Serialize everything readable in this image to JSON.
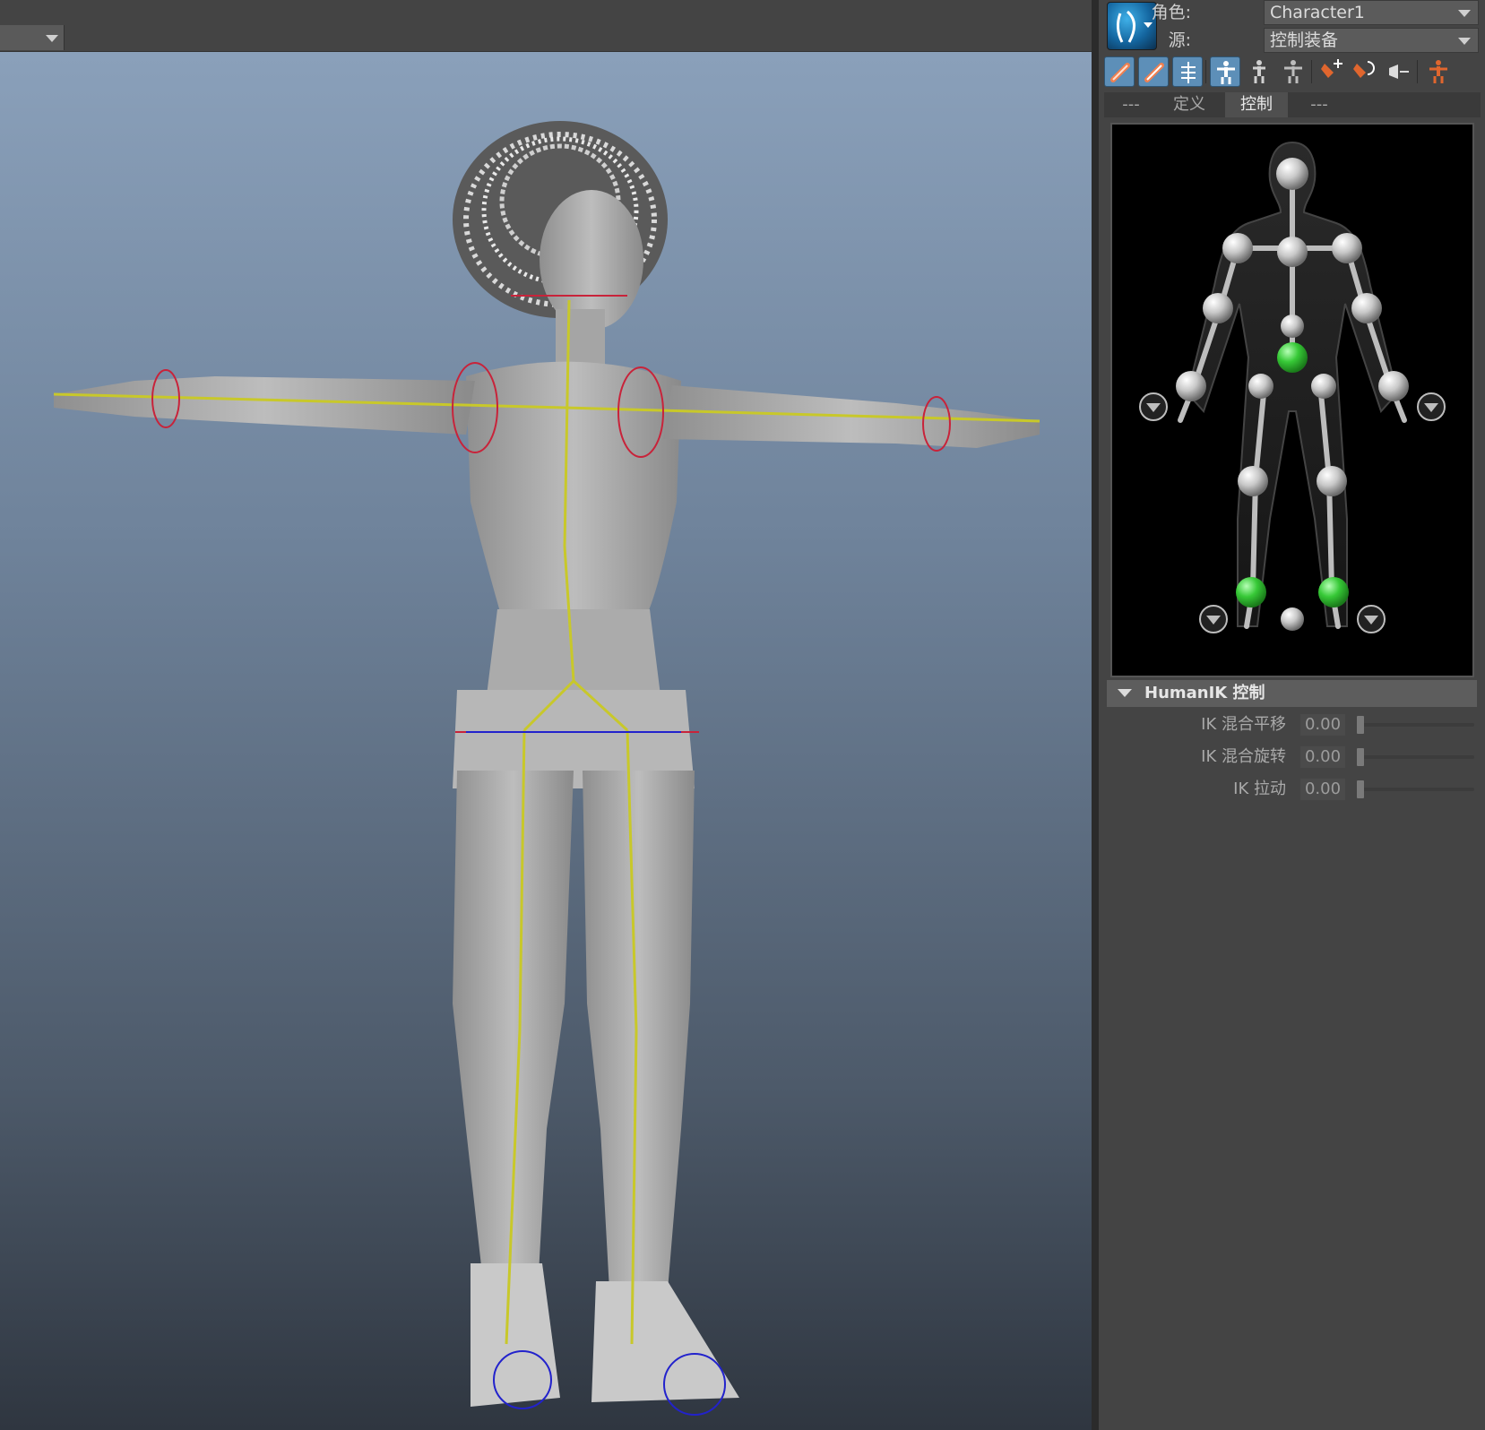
{
  "viewport": {
    "has_dropdown": true
  },
  "panel": {
    "character_label": "角色:",
    "character_value": "Character1",
    "source_label": "源:",
    "source_value": "控制装备",
    "tabs": [
      {
        "label": "---"
      },
      {
        "label": "定义"
      },
      {
        "label": "控制"
      },
      {
        "label": "---"
      }
    ],
    "active_tab": "控制",
    "tools": [
      {
        "icon": "fk-pencil-icon",
        "style": "blue"
      },
      {
        "icon": "ik-pencil-icon",
        "style": "blue"
      },
      {
        "icon": "skeleton-spine-icon",
        "style": "blue"
      },
      {
        "icon": "full-body-icon",
        "style": "blue"
      },
      {
        "icon": "body-part-icon",
        "style": "plain"
      },
      {
        "icon": "selection-icon",
        "style": "plain"
      },
      {
        "icon": "pin-translate-icon",
        "style": "plain"
      },
      {
        "icon": "pin-rotate-icon",
        "style": "plain"
      },
      {
        "icon": "release-pin-icon",
        "style": "plain"
      },
      {
        "icon": "pose-figure-icon",
        "style": "plain"
      }
    ],
    "section_title": "HumanIK 控制",
    "sliders": [
      {
        "label": "IK 混合平移",
        "value": "0.00",
        "fraction": 0.0
      },
      {
        "label": "IK 混合旋转",
        "value": "0.00",
        "fraction": 0.0
      },
      {
        "label": "IK 拉动",
        "value": "0.00",
        "fraction": 0.0
      }
    ]
  },
  "colors": {
    "skeleton_joint_selected": "#37c937",
    "skeleton_joint_normal": "#c8c8c8",
    "rig_lines": "#c8c82a",
    "tool_accent": "#e0662e"
  }
}
